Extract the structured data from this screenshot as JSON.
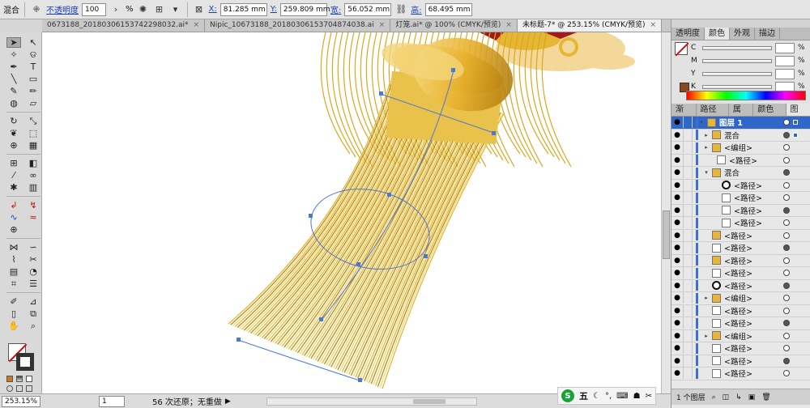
{
  "control": {
    "mode": "混合",
    "opacity_label": "不透明度",
    "opacity_value": "100",
    "pct": "%",
    "x_label": "X:",
    "x_value": "81.285 mm",
    "y_label": "Y:",
    "y_value": "259.809 mm",
    "w_label": "宽:",
    "w_value": "56.052 mm",
    "h_label": "高:",
    "h_value": "68.495 mm"
  },
  "tabs": [
    {
      "label": "0673188_20180306153742298032.ai*"
    },
    {
      "label": "Nipic_10673188_20180306153704874038.ai"
    },
    {
      "label": "灯笼.ai* @ 100% (CMYK/预览)"
    },
    {
      "label": "未标题-7* @ 253.15% (CMYK/预览)"
    }
  ],
  "status": {
    "zoom": "253.15%",
    "page": "1",
    "text": "56 次还原；无重做"
  },
  "ime": {
    "logo": "S",
    "label": "五"
  },
  "color_panel": {
    "tabs": [
      "透明度",
      "颜色",
      "外观",
      "描边"
    ],
    "channels": [
      "C",
      "M",
      "Y",
      "K"
    ],
    "pct": "%"
  },
  "layers_panel": {
    "tabs": [
      "渐变",
      "路径查",
      "属性",
      "颜色参",
      "图层"
    ],
    "rows": [
      {
        "label": "图层 1",
        "indent": 0,
        "thumb": "gold",
        "top": true
      },
      {
        "label": "混合",
        "indent": 1,
        "thumb": "gold"
      },
      {
        "label": "<编组>",
        "indent": 1,
        "thumb": "gold"
      },
      {
        "label": "<路径>",
        "indent": 2,
        "thumb": "white"
      },
      {
        "label": "混合",
        "indent": 1,
        "thumb": "gold"
      },
      {
        "label": "<路径>",
        "indent": 3,
        "thumb": "ring"
      },
      {
        "label": "<路径>",
        "indent": 3,
        "thumb": "white"
      },
      {
        "label": "<路径>",
        "indent": 3,
        "thumb": "white"
      },
      {
        "label": "<路径>",
        "indent": 3,
        "thumb": "white"
      },
      {
        "label": "<路径>",
        "indent": 1,
        "thumb": "gold"
      },
      {
        "label": "<路径>",
        "indent": 1,
        "thumb": "white"
      },
      {
        "label": "<路径>",
        "indent": 1,
        "thumb": "gold"
      },
      {
        "label": "<路径>",
        "indent": 1,
        "thumb": "white"
      },
      {
        "label": "<路径>",
        "indent": 1,
        "thumb": "ring"
      },
      {
        "label": "<编组>",
        "indent": 1,
        "thumb": "gold"
      },
      {
        "label": "<路径>",
        "indent": 1,
        "thumb": "white"
      },
      {
        "label": "<路径>",
        "indent": 1,
        "thumb": "white"
      },
      {
        "label": "<编组>",
        "indent": 1,
        "thumb": "gold"
      },
      {
        "label": "<路径>",
        "indent": 1,
        "thumb": "white"
      },
      {
        "label": "<路径>",
        "indent": 1,
        "thumb": "white"
      },
      {
        "label": "<路径>",
        "indent": 1,
        "thumb": "white"
      }
    ],
    "footer": "1 个图层"
  },
  "colors": {
    "gold": "#e6b635",
    "gold_dark": "#b88a12",
    "gold_light": "#f5d76e",
    "cream": "#f3d89a",
    "selection": "#4a78d4"
  }
}
